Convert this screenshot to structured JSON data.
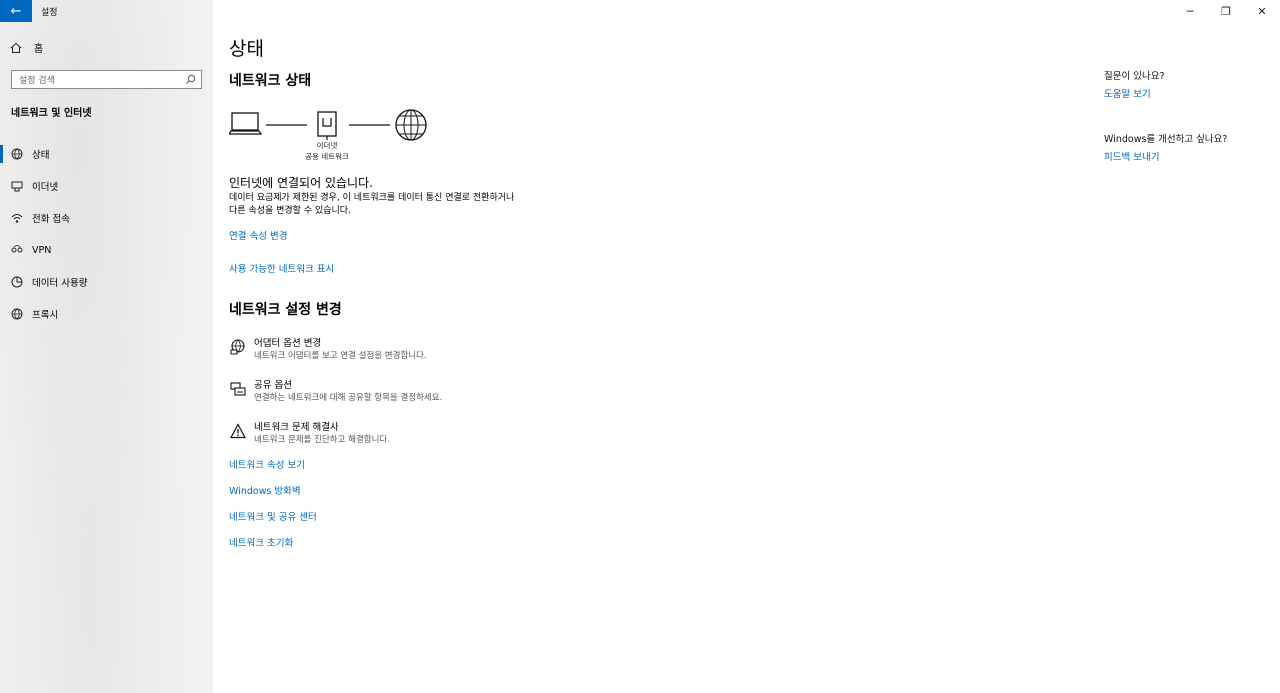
{
  "app": {
    "title": "설정",
    "back_symbol": "←"
  },
  "window_controls": {
    "minimize": "─",
    "restore": "❐",
    "close": "✕"
  },
  "sidebar": {
    "home_label": "홈",
    "search_placeholder": "설정 검색",
    "section_title": "네트워크 및 인터넷",
    "items": [
      {
        "label": "상태",
        "icon": "status-globe-icon"
      },
      {
        "label": "이더넷",
        "icon": "ethernet-icon"
      },
      {
        "label": "전화 접속",
        "icon": "dialup-icon"
      },
      {
        "label": "VPN",
        "icon": "vpn-icon"
      },
      {
        "label": "데이터 사용량",
        "icon": "data-usage-icon"
      },
      {
        "label": "프록시",
        "icon": "proxy-globe-icon"
      }
    ],
    "selected_index": 0
  },
  "main": {
    "page_title": "상태",
    "network_status_heading": "네트워크 상태",
    "diagram": {
      "adapter_label": "이더넷",
      "network_label": "공용 네트워크"
    },
    "status_main": "인터넷에 연결되어 있습니다.",
    "status_sub": "데이터 요금제가 제한된 경우, 이 네트워크를 데이터 통신 연결로 전환하거나 다른 속성을 변경할 수 있습니다.",
    "link_change_properties": "연결 속성 변경",
    "link_show_networks": "사용 가능한 네트워크 표시",
    "change_settings_heading": "네트워크 설정 변경",
    "settings": [
      {
        "title": "어댑터 옵션 변경",
        "desc": "네트워크 어댑터를 보고 연결 설정을 변경합니다.",
        "icon": "adapter-icon"
      },
      {
        "title": "공유 옵션",
        "desc": "연결하는 네트워크에 대해 공유할 항목을 결정하세요.",
        "icon": "sharing-icon"
      },
      {
        "title": "네트워크 문제 해결사",
        "desc": "네트워크 문제를 진단하고 해결합니다.",
        "icon": "warning-icon"
      }
    ],
    "links": [
      "네트워크 속성 보기",
      "Windows 방화벽",
      "네트워크 및 공유 센터",
      "네트워크 초기화"
    ]
  },
  "right": {
    "question_heading": "질문이 있나요?",
    "help_link": "도움말 보기",
    "improve_heading": "Windows를 개선하고 싶나요?",
    "feedback_link": "피드백 보내기"
  },
  "colors": {
    "accent": "#0067c0",
    "sidebar_bg": "#f1f1f1"
  }
}
